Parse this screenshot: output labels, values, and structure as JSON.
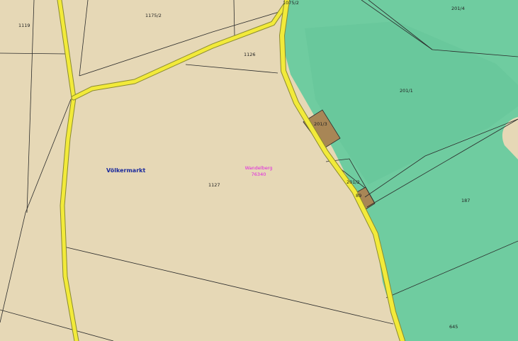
{
  "map": {
    "colors": {
      "farmland": "#e6d8b6",
      "forest": "#6fcca0",
      "road": "#f2ea3a",
      "building": "#a88656",
      "boundary": "#2b2b2b",
      "place_label": "#1b2a9c",
      "cadastral_label": "#e020e0"
    },
    "place_name": "Völkermarkt",
    "cadastral_community": {
      "name": "Wandelberg",
      "code": "76340"
    },
    "parcels": [
      {
        "id": "1119"
      },
      {
        "id": "1175/2"
      },
      {
        "id": "1075/2"
      },
      {
        "id": "201/4"
      },
      {
        "id": "1126"
      },
      {
        "id": "201/1"
      },
      {
        "id": "201/3"
      },
      {
        "id": "1127"
      },
      {
        "id": "201/2"
      },
      {
        "id": "89"
      },
      {
        "id": "187"
      },
      {
        "id": "645"
      }
    ]
  }
}
